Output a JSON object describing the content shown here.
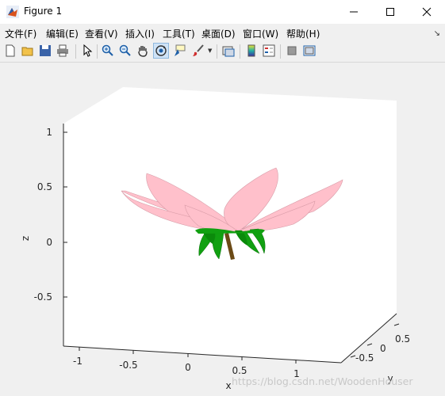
{
  "window": {
    "title": "Figure 1"
  },
  "menu": [
    "文件(F)",
    "编辑(E)",
    "查看(V)",
    "插入(I)",
    "工具(T)",
    "桌面(D)",
    "窗口(W)",
    "帮助(H)"
  ],
  "toolbar": {
    "icons": [
      "new-figure-icon",
      "open-file-icon",
      "save-icon",
      "print-icon",
      "edit-plot-arrow-icon",
      "zoom-in-icon",
      "zoom-out-icon",
      "pan-hand-icon",
      "rotate-3d-icon",
      "data-cursor-icon",
      "brush-icon",
      "link-plot-icon",
      "colorbar-icon",
      "legend-icon",
      "hide-plot-tools-icon",
      "show-plot-tools-icon"
    ]
  },
  "plot": {
    "z_label": "z",
    "x_label": "x",
    "y_label": "y",
    "z_ticks": [
      "1",
      "0.5",
      "0",
      "-0.5"
    ],
    "x_ticks": [
      "-1",
      "-0.5",
      "0",
      "0.5",
      "1"
    ],
    "y_ticks": [
      "0.5",
      "0",
      "-0.5"
    ],
    "petal_color": "#ffc0cb",
    "leaf_color": "#11a011",
    "stem_color": "#6b4a16"
  },
  "watermark": "https://blog.csdn.net/WoodenHouser"
}
